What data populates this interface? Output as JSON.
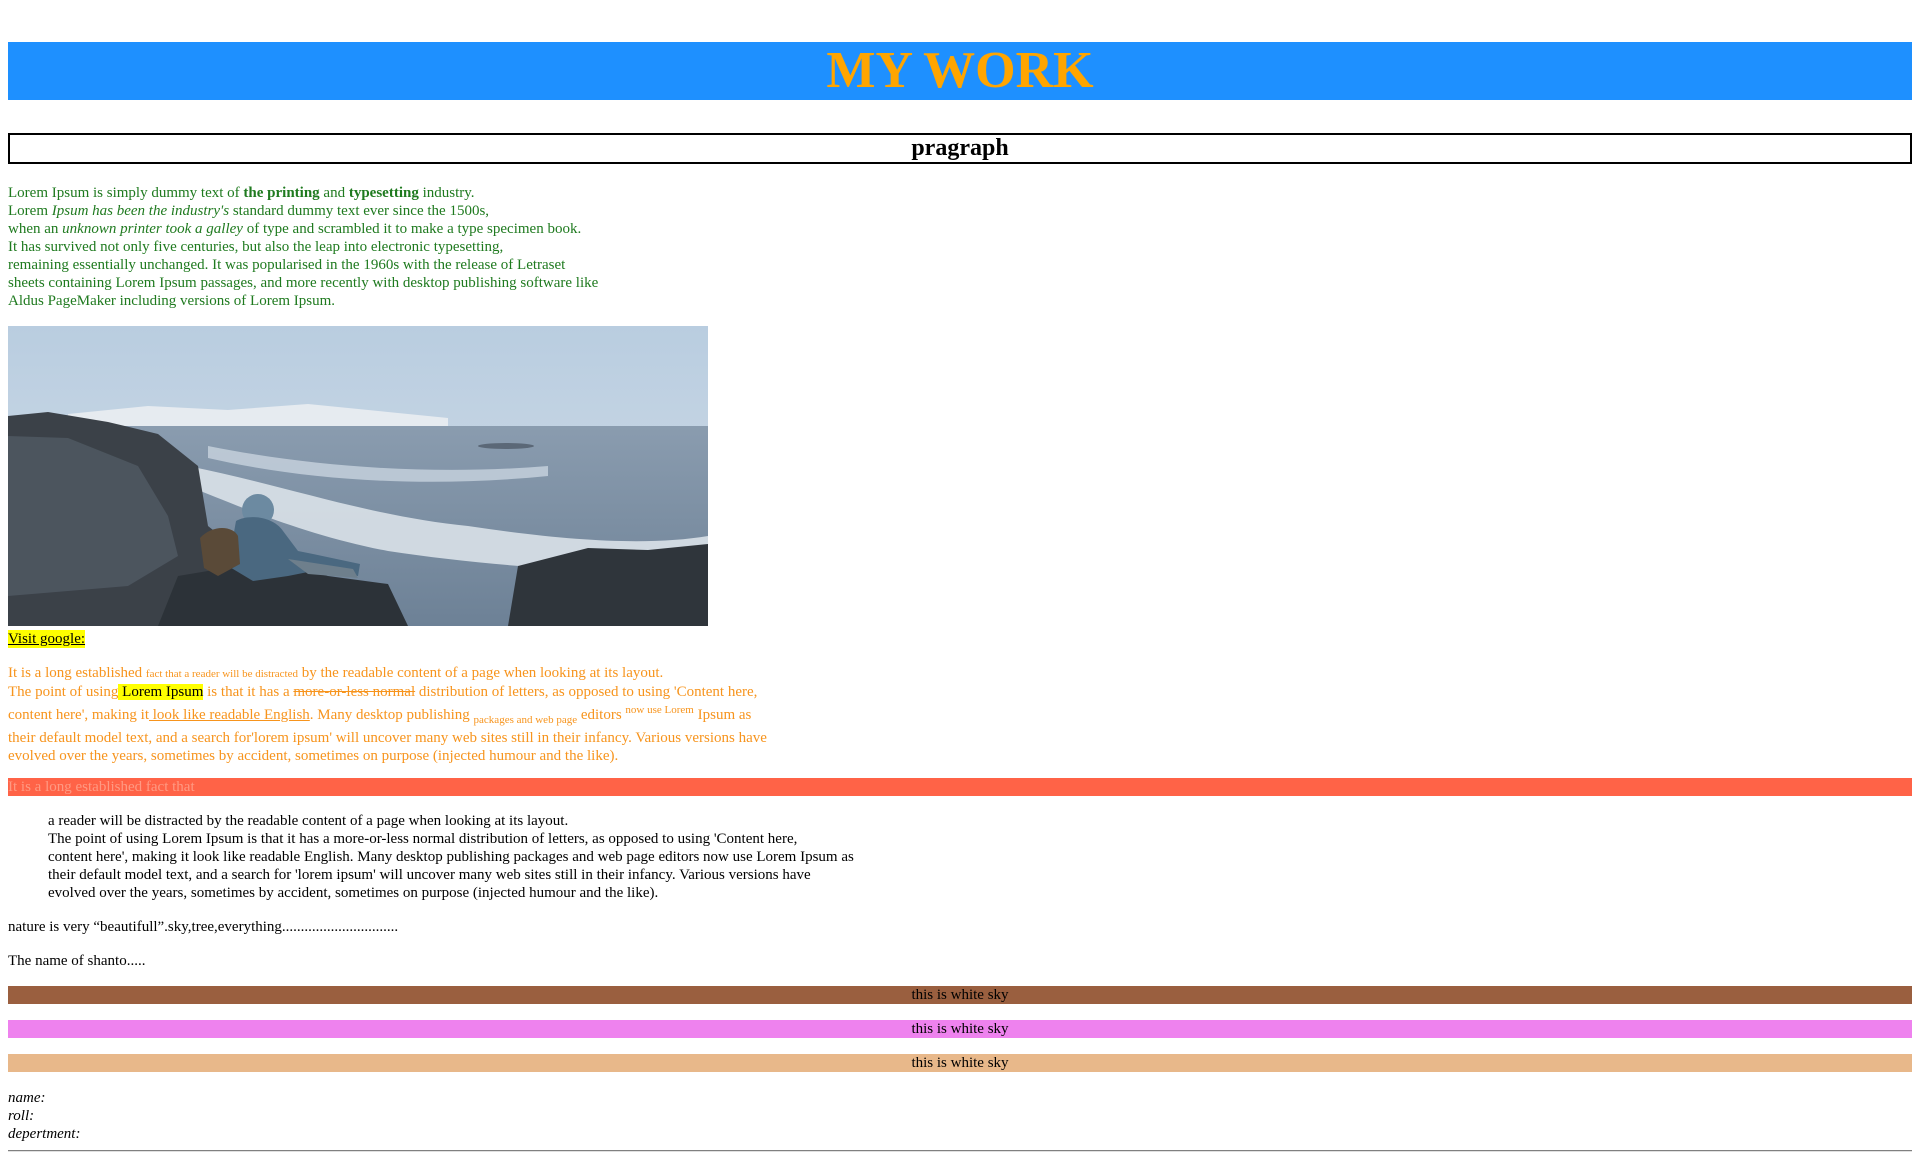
{
  "header": {
    "title": "MY WORK"
  },
  "subheading": "pragraph",
  "green": {
    "s1": "Lorem Ipsum is simply dummy text of ",
    "b1": "the printing",
    "s2": " and ",
    "b2": "typesetting",
    "s3": " industry.",
    "s4": "Lorem ",
    "i1": "Ipsum has been the industry's",
    "s5": " standard dummy text ever since the 1500s,",
    "s6": "when an ",
    "i2": "unknown printer took a galley",
    "s7": " of type and scrambled it to make a type specimen book.",
    "l4": "It has survived not only five centuries, but also the leap into electronic typesetting,",
    "l5": "remaining essentially unchanged. It was popularised in the 1960s with the release of Letraset",
    "l6": "sheets containing Lorem Ipsum passages, and more recently with desktop publishing software like",
    "l7": "Aldus PageMaker including versions of Lorem Ipsum."
  },
  "link": {
    "label": "Visit google:"
  },
  "orange": {
    "a1": "It is a long established ",
    "a2": "fact that a reader will be distracted",
    "a3": " by the readable content of a page when looking at its layout.",
    "b1": "The point of using",
    "b2": " Lorem Ipsum",
    "b3": " is that it has a ",
    "b4": "more-or-less normal",
    "b5": " distribution of letters, as opposed to using 'Content here,",
    "c1": "content here', making it",
    "c2": " look like readable English",
    "c3": ". Many desktop publishing ",
    "c4": "packages and web page",
    "c5": " editors ",
    "c6": "now use Lorem",
    "c7": " Ipsum as",
    "d1": "their default model text, and a search for'lorem ipsum' will uncover many web sites still in their infancy. Various versions have",
    "e1": "evolved over the years, sometimes by accident, sometimes on purpose (injected humour and the like)."
  },
  "tomato": "It is a long established fact that",
  "black": {
    "l1": "a reader will be distracted by the readable content of a page when looking at its layout.",
    "l2": "The point of using Lorem Ipsum is that it has a more-or-less normal distribution of letters, as opposed to using 'Content here,",
    "l3": "content here', making it look like readable English. Many desktop publishing packages and web page editors now use Lorem Ipsum as",
    "l4": "their default model text, and a search for 'lorem ipsum' will uncover many web sites still in their infancy. Various versions have",
    "l5": "evolved over the years, sometimes by accident, sometimes on purpose (injected humour and the like)."
  },
  "nature": "nature is very “beautifull”.sky,tree,everything...............................",
  "name_line": "The name of shanto.....",
  "sky_bars": [
    {
      "label": "this is white sky",
      "color": "#9a5f3f"
    },
    {
      "label": "this is white sky",
      "color": "#ee82ee"
    },
    {
      "label": "this is white sky",
      "color": "#e8b88a"
    }
  ],
  "info": {
    "name": "name:",
    "roll": "roll:",
    "dept": "depertment:"
  },
  "colors": {
    "header_bg": "#1e90ff",
    "header_text": "#ffa500",
    "green_text": "#1f7a1f",
    "orange_text": "#f7941d",
    "tomato": "#ff6347",
    "highlight": "#ffff00"
  }
}
